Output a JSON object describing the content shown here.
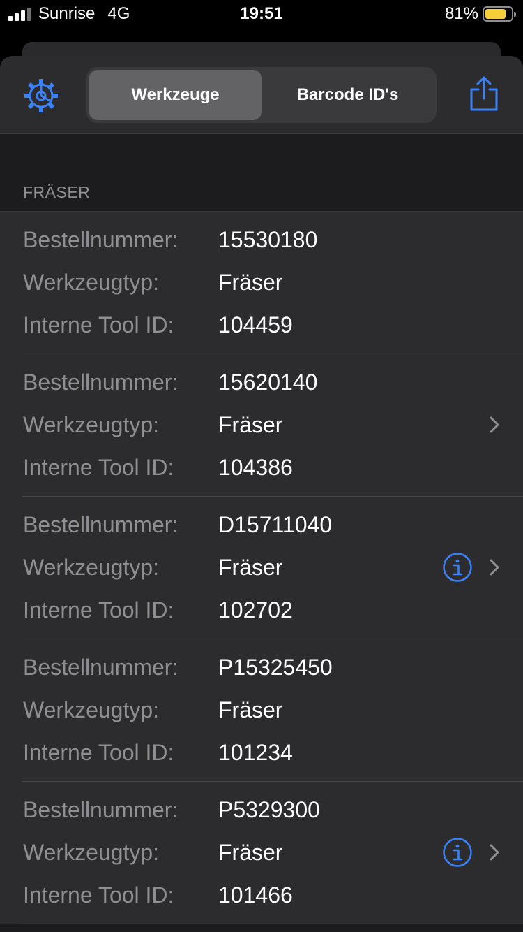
{
  "status_bar": {
    "carrier": "Sunrise",
    "network": "4G",
    "time": "19:51",
    "battery_percent": "81%",
    "battery_level": 0.81,
    "battery_color": "#f4cf3a"
  },
  "toolbar": {
    "settings_icon": "gear-icon",
    "share_icon": "share-icon",
    "segments": [
      {
        "label": "Werkzeuge",
        "selected": true
      },
      {
        "label": "Barcode ID's",
        "selected": false
      }
    ],
    "accent_color": "#3b82f6"
  },
  "section": {
    "title": "FRÄSER"
  },
  "labels": {
    "order_number": "Bestellnummer:",
    "tool_type": "Werkzeugtyp:",
    "internal_id": "Interne Tool ID:"
  },
  "items": [
    {
      "order_number": "15530180",
      "tool_type": "Fräser",
      "internal_id": "104459",
      "info": false,
      "chevron": false
    },
    {
      "order_number": "15620140",
      "tool_type": "Fräser",
      "internal_id": "104386",
      "info": false,
      "chevron": true
    },
    {
      "order_number": "D15711040",
      "tool_type": "Fräser",
      "internal_id": "102702",
      "info": true,
      "chevron": true
    },
    {
      "order_number": "P15325450",
      "tool_type": "Fräser",
      "internal_id": "101234",
      "info": false,
      "chevron": false
    },
    {
      "order_number": "P5329300",
      "tool_type": "Fräser",
      "internal_id": "101466",
      "info": true,
      "chevron": true
    }
  ]
}
